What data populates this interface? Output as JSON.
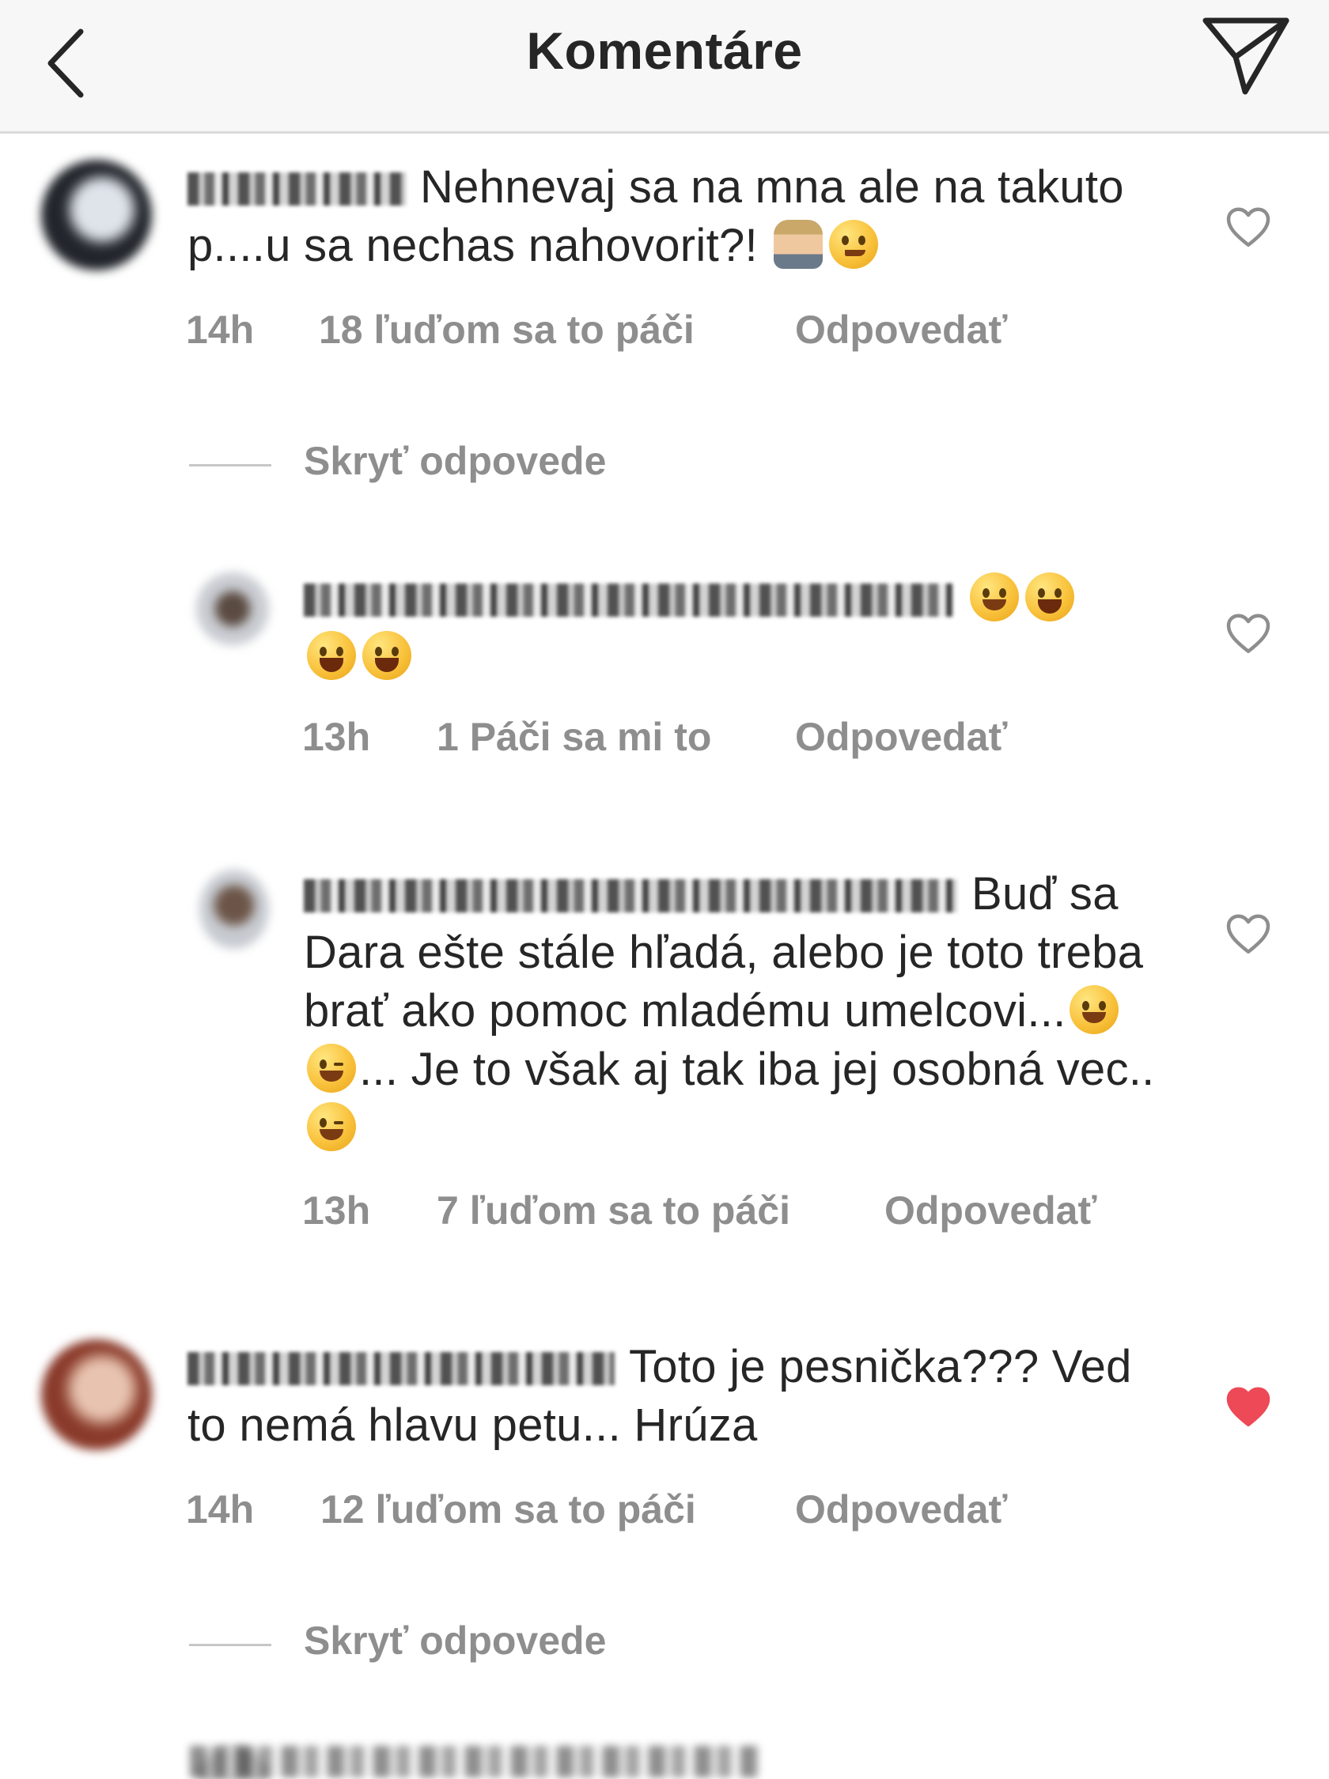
{
  "header": {
    "title": "Komentáre",
    "back_icon": "chevron-left-icon",
    "send_icon": "paper-plane-icon"
  },
  "colors": {
    "meta_text": "#8e8e8e",
    "like_filled": "#ed4956",
    "header_bg": "#f7f7f7"
  },
  "comments": [
    {
      "text": "Nehnevaj sa na mna ale na takuto p....u sa nechas nahovorit?!",
      "time": "14h",
      "likes": "18 ľuďom sa to páči",
      "reply": "Odpovedať",
      "liked": false
    },
    {
      "hide_replies": "Skryť odpovede"
    },
    {
      "text": "",
      "time": "13h",
      "likes": "1 Páči sa mi to",
      "reply": "Odpovedať",
      "liked": false
    },
    {
      "text": "Buď sa Dara ešte stále hľadá, alebo je toto treba brať ako pomoc mladému umelcovi...",
      "text_cont": "... Je to však aj tak iba jej osobná vec..",
      "time": "13h",
      "likes": "7 ľuďom sa to páči",
      "reply": "Odpovedať",
      "liked": false
    },
    {
      "text": "Toto je pesnička??? Ved to nemá hlavu petu... Hrúza",
      "time": "14h",
      "likes": "12 ľuďom sa to páči",
      "reply": "Odpovedať",
      "liked": true
    },
    {
      "hide_replies": "Skryť odpovede"
    }
  ]
}
